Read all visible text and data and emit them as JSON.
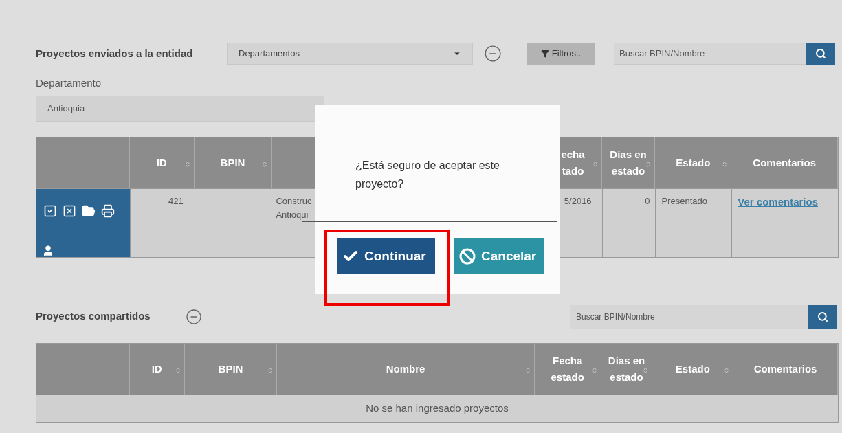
{
  "sent_section": {
    "title": "Proyectos enviados a la entidad",
    "dropdown_value": "Departamentos",
    "filter_button": "Filtros..",
    "search_placeholder": "Buscar BPIN/Nombre",
    "department_label": "Departamento",
    "department_value": "Antioquia",
    "columns": [
      {},
      {
        "lines": [
          "ID"
        ],
        "sortable": true
      },
      {
        "lines": [
          "BPIN"
        ],
        "sortable": true
      },
      {},
      {
        "lines": [
          "echa",
          "tado"
        ],
        "sortable": true
      },
      {
        "lines": [
          "Días en",
          "estado"
        ],
        "sortable": true
      },
      {
        "lines": [
          "Estado"
        ],
        "sortable": true
      },
      {
        "lines": [
          "Comentarios"
        ]
      }
    ],
    "rows": [
      {
        "id": "421",
        "bpin": "",
        "name_lines": [
          "Construc",
          "Antioqui"
        ],
        "date": "5/2016",
        "days": "0",
        "status": "Presentado",
        "comments_link": "Ver comentarios"
      }
    ]
  },
  "shared_section": {
    "title": "Proyectos compartidos",
    "search_placeholder": "Buscar BPIN/Nombre",
    "columns": [
      {},
      {
        "lines": [
          "ID"
        ],
        "sortable": true
      },
      {
        "lines": [
          "BPIN"
        ],
        "sortable": true
      },
      {
        "lines": [
          "Nombre"
        ],
        "sortable": true
      },
      {
        "lines": [
          "Fecha",
          "estado"
        ],
        "sortable": true
      },
      {
        "lines": [
          "Días en",
          "estado"
        ],
        "sortable": true
      },
      {
        "lines": [
          "Estado"
        ],
        "sortable": true
      },
      {
        "lines": [
          "Comentarios"
        ]
      }
    ],
    "empty_message": "No se han ingresado proyectos"
  },
  "dialog": {
    "message": "¿Está seguro de aceptar este proyecto?",
    "buttons": [
      {
        "kind": "confirm",
        "label": "Continuar",
        "highlighted": true
      },
      {
        "kind": "cancel",
        "label": "Cancelar",
        "highlighted": false
      }
    ]
  }
}
